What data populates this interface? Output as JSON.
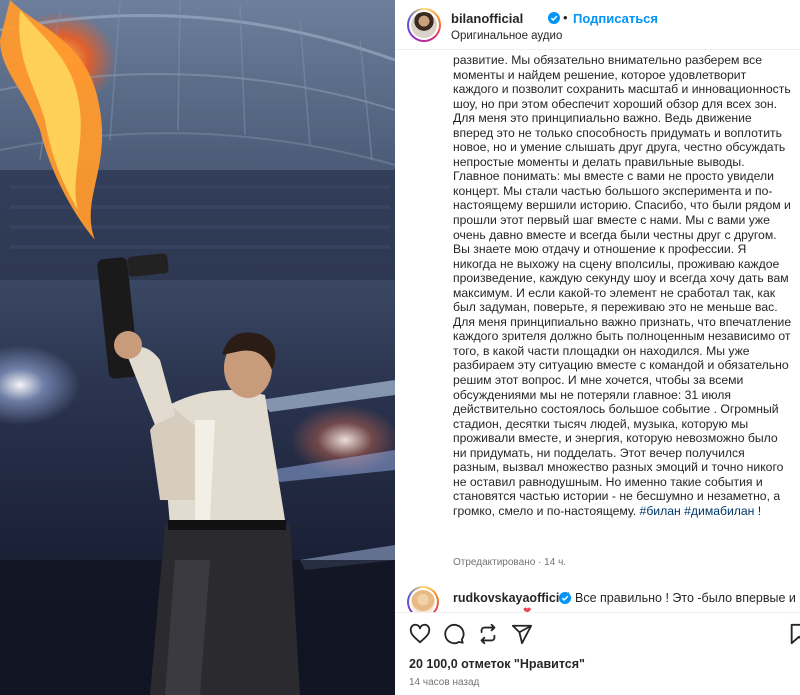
{
  "post": {
    "username": "bilanofficial",
    "follow_label": "Подписаться",
    "dot": "•",
    "audio": "Оригинальное аудио",
    "caption_text": "развитие. Мы обязательно внимательно разберем все моменты и найдем решение, которое удовлетворит каждого и позволит сохранить масштаб и инновационность шоу, но при этом обеспечит хороший обзор для всех зон. Для меня это принципиально важно. Ведь движение вперед это не только способность придумать и воплотить новое, но и умение слышать друг друга, честно обсуждать непростые моменты и делать правильные выводы.\nГлавное понимать: мы вместе с вами не просто увидели концерт. Мы стали частью большого эксперимента и по-настоящему вершили историю. Спасибо, что были рядом и прошли этот первый шаг вместе с нами. Мы с вами уже очень давно вместе и всегда были честны друг с другом. Вы знаете мою отдачу и отношение к профессии. Я никогда не выхожу на сцену вполсилы, проживаю каждое произведение, каждую секунду шоу и всегда хочу дать вам максимум. И если какой-то элемент не сработал так, как был задуман, поверьте, я переживаю это не меньше вас. Для меня принципиально важно признать, что впечатление каждого зрителя должно быть полноценным независимо от того, в какой части площадки он находился. Мы уже разбираем эту ситуацию вместе с командой и обязательно решим этот вопрос. И мне хочется, чтобы за всеми обсуждениями мы не потеряли главное: 31 июля действительно состоялось большое событие . Огромный стадион, десятки тысяч людей, музыка, которую мы проживали вместе, и энергия, которую невозможно было ни придумать, ни подделать. Этот вечер получился разным, вызвал множество разных эмоций и точно никого не оставил равнодушным. Но именно такие события и становятся частью истории - не бесшумно и незаметно, а громко, смело и по-настоящему. ",
    "hashtags": "#билан #димабилан",
    "caption_tail": " !",
    "edited_label": "Отредактировано · 14 ч."
  },
  "comment": {
    "username": "rudkovskayaofficial",
    "text": "Все правильно ! Это -было впервые и",
    "heart": "❤"
  },
  "actions": {
    "icons": [
      "heart-icon",
      "comment-icon",
      "share-icon",
      "send-icon",
      "bookmark-icon"
    ]
  },
  "likes": "20 100,0 отметок \"Нравится\"",
  "time_ago": "14 часов назад",
  "colors": {
    "link": "#0095f6",
    "hashtag": "#00376b",
    "verified": "#0095f6",
    "meta": "#737373"
  }
}
